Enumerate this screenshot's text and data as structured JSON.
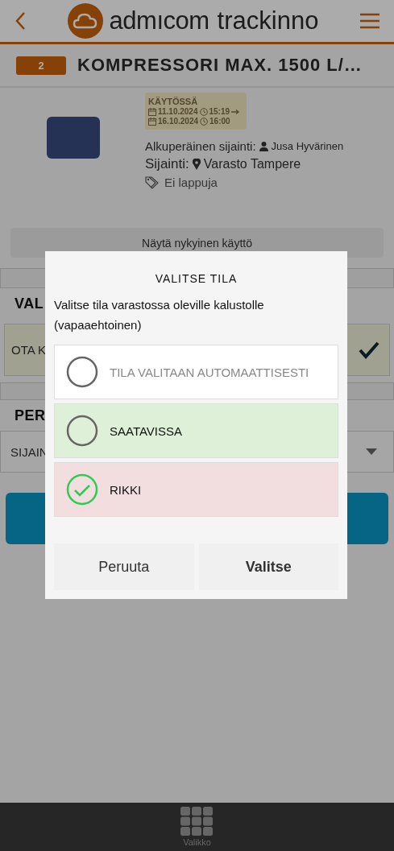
{
  "header": {
    "logo_words": [
      "admıcom",
      "trackinno"
    ]
  },
  "item": {
    "badge": "2",
    "title": "KOMPRESSORI MAX. 1500 L/…"
  },
  "status": {
    "label": "KÄYTÖSSÄ",
    "periods": [
      {
        "date": "11.10.2024",
        "time": "15:19",
        "arrow": true
      },
      {
        "date": "16.10.2024",
        "time": "16:00",
        "arrow": false
      }
    ]
  },
  "details": {
    "original_label": "Alkuperäinen sijainti:",
    "original_value": "Jusa Hyvärinen",
    "location_label": "Sijainti:",
    "location_value": "Varasto Tampere",
    "tags": "Ei lappuja"
  },
  "show_usage_button": "Näytä nykyinen käyttö",
  "background": {
    "heading_1": "VAL",
    "card_text": "OTA K",
    "card_checked": true,
    "heading_2": "PER",
    "select_text": "SIJAIN"
  },
  "dialog": {
    "title": "VALITSE TILA",
    "description": "Valitse tila varastossa oleville kalustolle (vapaaehtoinen)",
    "options": [
      {
        "label": "TILA VALITAAN AUTOMAATTISESTI",
        "selected": false,
        "color": "#ffffff",
        "muted": true
      },
      {
        "label": "SAATAVISSA",
        "selected": false,
        "color": "#dff0d8",
        "muted": false
      },
      {
        "label": "RIKKI",
        "selected": true,
        "color": "#f2dede",
        "muted": false
      }
    ],
    "buttons": [
      {
        "label": "Peruuta",
        "primary": false
      },
      {
        "label": "Valitse",
        "primary": true
      }
    ]
  },
  "footer": {
    "label": "Valikko"
  }
}
